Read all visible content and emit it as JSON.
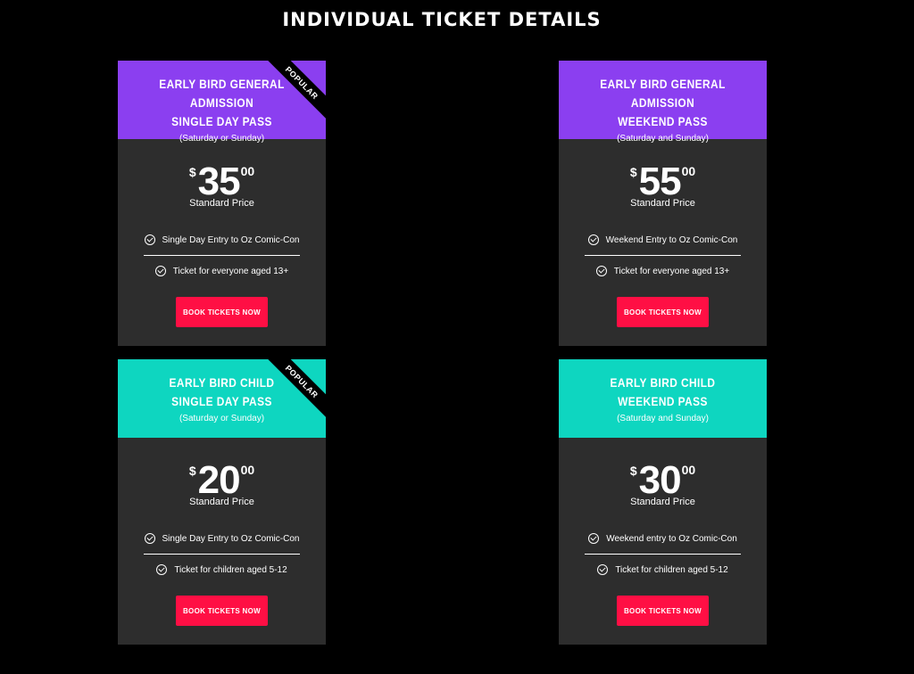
{
  "page": {
    "title": "INDIVIDUAL TICKET DETAILS"
  },
  "colors": {
    "purple": "#8b3ff0",
    "teal": "#0ed6c0",
    "card_bg": "#2d2d2d",
    "button": "#ff0f44"
  },
  "cards": [
    {
      "title_line1": "EARLY BIRD GENERAL ADMISSION",
      "title_line2": "SINGLE DAY PASS",
      "subtitle": "(Saturday or Sunday)",
      "ribbon": "POPULAR",
      "currency": "$",
      "amount": "35",
      "cents": "00",
      "price_label": "Standard Price",
      "feature1": "Single Day Entry to Oz Comic-Con",
      "feature2": "Ticket for everyone aged 13+",
      "button": "BOOK TICKETS NOW"
    },
    {
      "title_line1": "EARLY BIRD GENERAL ADMISSION",
      "title_line2": "WEEKEND PASS",
      "subtitle": "(Saturday and Sunday)",
      "currency": "$",
      "amount": "55",
      "cents": "00",
      "price_label": "Standard Price",
      "feature1": "Weekend Entry to Oz Comic-Con",
      "feature2": "Ticket for everyone aged 13+",
      "button": "BOOK TICKETS NOW"
    },
    {
      "title_line1": "EARLY BIRD CHILD",
      "title_line2": "SINGLE DAY PASS",
      "subtitle": "(Saturday or Sunday)",
      "ribbon": "POPULAR",
      "currency": "$",
      "amount": "20",
      "cents": "00",
      "price_label": "Standard Price",
      "feature1": "Single Day Entry to Oz Comic-Con",
      "feature2": "Ticket for children aged 5-12",
      "button": "BOOK TICKETS NOW"
    },
    {
      "title_line1": "EARLY BIRD CHILD",
      "title_line2": "WEEKEND PASS",
      "subtitle": "(Saturday and Sunday)",
      "currency": "$",
      "amount": "30",
      "cents": "00",
      "price_label": "Standard Price",
      "feature1": "Weekend entry to Oz Comic-Con",
      "feature2": "Ticket for children aged 5-12",
      "button": "BOOK TICKETS NOW"
    }
  ]
}
